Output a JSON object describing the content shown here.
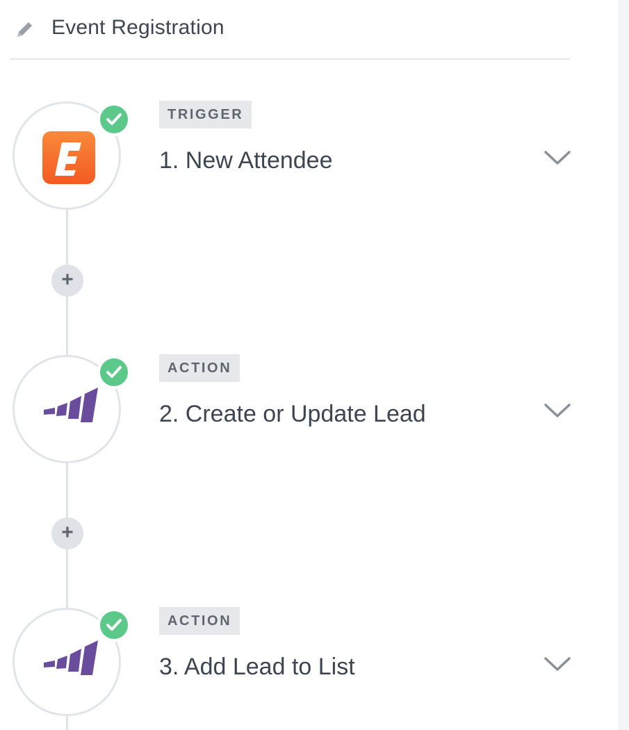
{
  "header": {
    "edit_icon": "pencil-icon",
    "title": "Event Registration"
  },
  "steps": [
    {
      "type_label": "TRIGGER",
      "title": "1. New Attendee",
      "app_icon": "eventbrite-logo",
      "status": "complete",
      "status_color": "#5cc98b",
      "brand_color": "#f6682f"
    },
    {
      "type_label": "ACTION",
      "title": "2. Create or Update Lead",
      "app_icon": "marketo-logo",
      "status": "complete",
      "status_color": "#5cc98b",
      "brand_color": "#6a4c9c"
    },
    {
      "type_label": "ACTION",
      "title": "3. Add Lead to List",
      "app_icon": "marketo-logo",
      "status": "complete",
      "status_color": "#5cc98b",
      "brand_color": "#6a4c9c"
    }
  ],
  "add_step_buttons": [
    {
      "label": "+"
    },
    {
      "label": "+"
    }
  ],
  "icons": {
    "expand": "chevron-down-icon",
    "status": "check-icon"
  }
}
